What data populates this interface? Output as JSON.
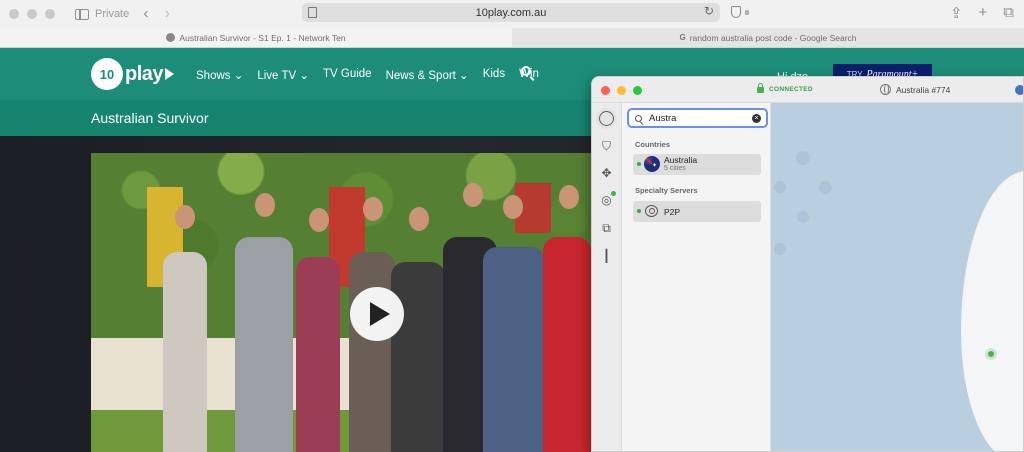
{
  "browser": {
    "private_label": "Private",
    "url": "10play.com.au",
    "tabs": [
      {
        "title": "Australian Survivor - S1 Ep. 1 - Network Ten"
      },
      {
        "title": "random australia post code - Google Search"
      }
    ]
  },
  "site": {
    "logo_number": "10",
    "logo_text": "play",
    "menu": [
      "Shows ⌄",
      "Live TV ⌄",
      "TV Guide",
      "News & Sport ⌄",
      "Kids",
      "Win"
    ],
    "greeting": "Hi dzo ⌄",
    "promo_prefix": "TRY",
    "promo_brand": "Paramount+",
    "show_title": "Australian Survivor"
  },
  "vpn": {
    "status": "CONNECTED",
    "server": "Australia #774",
    "search_value": "Austra",
    "sections": {
      "countries": "Countries",
      "specialty": "Specialty Servers"
    },
    "country_row": {
      "name": "Australia",
      "sub": "5 cities"
    },
    "specialty_row": {
      "name": "P2P"
    },
    "colors": {
      "connected": "#3a9b4d",
      "accent": "#6a8ff0"
    }
  }
}
